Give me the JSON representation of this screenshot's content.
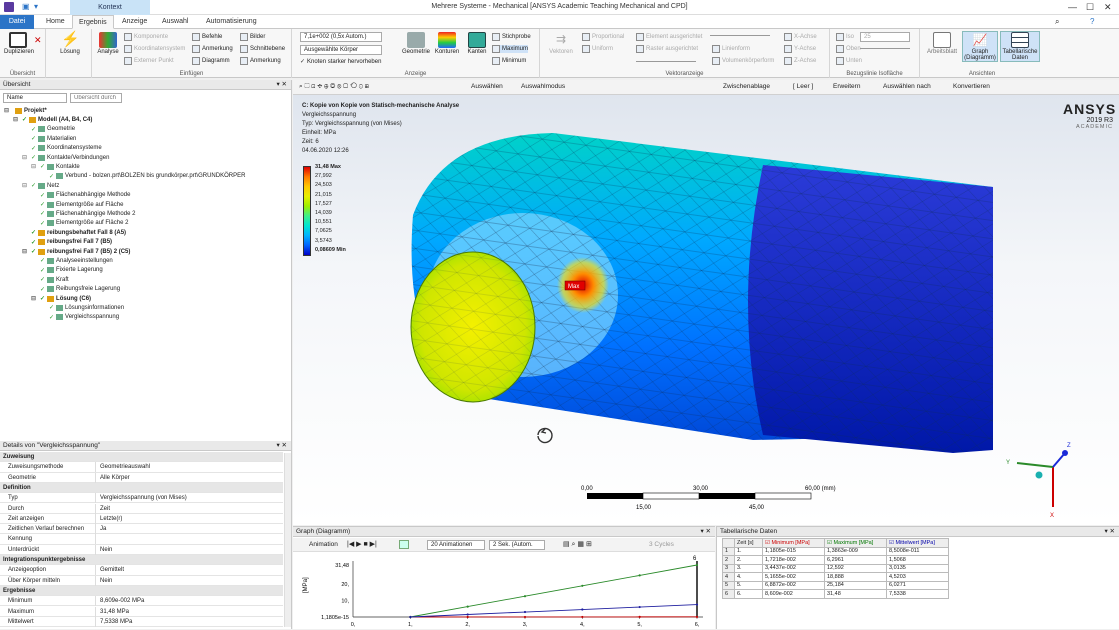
{
  "window": {
    "title": "Mehrere Systeme - Mechanical [ANSYS Academic Teaching Mechanical and CPD]",
    "context_tab": "Kontext",
    "search_placeholder": "Schnellstart"
  },
  "tabs": [
    "Datei",
    "Home",
    "Ergebnis",
    "Anzeige",
    "Auswahl",
    "Automatisierung"
  ],
  "ribbon": {
    "uebersicht": {
      "dup": "Duplizieren",
      "group": "Übersicht"
    },
    "loesung": "Lösung",
    "analyse": "Analyse",
    "einfuegen": {
      "group": "Einfügen",
      "items": [
        "Komponente",
        "Koordinatensystem",
        "Externer Punkt",
        "Befehle",
        "Anmerkung",
        "Diagramm",
        "Bilder",
        "Schnittebene",
        "Anmerkung"
      ]
    },
    "anzeige": {
      "group": "Anzeige",
      "scale": "7,1e+002 (0,5x Autom.)",
      "bodies": "Ausgewählte Körper",
      "knoten": "Knoten starker hervorheben",
      "buttons": [
        "Geometrie",
        "Konturen",
        "Kanten"
      ],
      "probe": [
        "Stichprobe",
        "Maximum",
        "Minimum"
      ]
    },
    "vektor": {
      "group": "Vektoranzeige",
      "items": [
        "Vektoren",
        "Proportional",
        "Uniform",
        "Element ausgerichtet",
        "Raster ausgerichtet",
        "Linienform",
        "Volumenkörperform",
        "X-Achse",
        "Y-Achse",
        "Z-Achse"
      ]
    },
    "bezug": {
      "group": "Bezugslinie Isofläche",
      "items": [
        "Iso",
        "Oben",
        "Unten"
      ],
      "value": "25"
    },
    "ansichten": {
      "group": "Ansichten",
      "items": [
        "Arbeitsblatt",
        "Graph (Diagramm)",
        "Tabellarische Daten"
      ]
    }
  },
  "tree": {
    "title": "Übersicht",
    "filter": "Name",
    "search_placeholder": "Übersicht durch",
    "nodes": [
      {
        "label": "Projekt*",
        "depth": 0,
        "bold": true
      },
      {
        "label": "Modell (A4, B4, C4)",
        "depth": 1,
        "bold": true
      },
      {
        "label": "Geometrie",
        "depth": 2
      },
      {
        "label": "Materialien",
        "depth": 2
      },
      {
        "label": "Koordinatensysteme",
        "depth": 2
      },
      {
        "label": "Kontakte/Verbindungen",
        "depth": 2
      },
      {
        "label": "Kontakte",
        "depth": 3
      },
      {
        "label": "Verbund - bolzen.prt\\BOLZEN bis grundkörper.prt\\GRUNDKÖRPER",
        "depth": 4
      },
      {
        "label": "Netz",
        "depth": 2
      },
      {
        "label": "Flächenabhängige Methode",
        "depth": 3
      },
      {
        "label": "Elementgröße auf Fläche",
        "depth": 3
      },
      {
        "label": "Flächenabhängige Methode 2",
        "depth": 3
      },
      {
        "label": "Elementgröße auf Fläche 2",
        "depth": 3
      },
      {
        "label": "reibungsbehaftet Fall 8 (A5)",
        "depth": 2,
        "bold": true
      },
      {
        "label": "reibungsfrei Fall 7 (B5)",
        "depth": 2,
        "bold": true
      },
      {
        "label": "reibungsfrei Fall 7 (B5) 2 (C5)",
        "depth": 2,
        "bold": true
      },
      {
        "label": "Analyseeinstellungen",
        "depth": 3
      },
      {
        "label": "Fixierte Lagerung",
        "depth": 3
      },
      {
        "label": "Kraft",
        "depth": 3
      },
      {
        "label": "Reibungsfreie Lagerung",
        "depth": 3
      },
      {
        "label": "Lösung (C6)",
        "depth": 3,
        "bold": true
      },
      {
        "label": "Lösungsinformationen",
        "depth": 4
      },
      {
        "label": "Vergleichsspannung",
        "depth": 4
      }
    ]
  },
  "details": {
    "title": "Details von \"Vergleichsspannung\"",
    "rows": [
      {
        "section": "Zuweisung"
      },
      {
        "k": "Zuweisungsmethode",
        "v": "Geometrieauswahl"
      },
      {
        "k": "Geometrie",
        "v": "Alle Körper"
      },
      {
        "section": "Definition"
      },
      {
        "k": "Typ",
        "v": "Vergleichsspannung (von Mises)"
      },
      {
        "k": "Durch",
        "v": "Zeit"
      },
      {
        "k": "Zeit anzeigen",
        "v": "Letzte(r)"
      },
      {
        "k": "Zeitlichen Verlauf berechnen",
        "v": "Ja"
      },
      {
        "k": "Kennung",
        "v": ""
      },
      {
        "k": "Unterdrückt",
        "v": "Nein"
      },
      {
        "section": "Integrationspunktergebnisse"
      },
      {
        "k": "Anzeigeoption",
        "v": "Gemittelt"
      },
      {
        "k": "Über Körper mitteln",
        "v": "Nein"
      },
      {
        "section": "Ergebnisse"
      },
      {
        "k": "Minimum",
        "v": "8,609e-002 MPa"
      },
      {
        "k": "Maximum",
        "v": "31,48 MPa"
      },
      {
        "k": "Mittelwert",
        "v": "7,5338 MPa"
      }
    ]
  },
  "view_toolbar": {
    "select": "Auswählen",
    "mode": "Auswahlmodus",
    "clipboard": "Zwischenablage",
    "empty": "[ Leer ]",
    "expand": "Erweitern",
    "select_by": "Auswählen nach",
    "convert": "Konvertieren"
  },
  "viewport": {
    "header": [
      "C: Kopie von Kopie von Statisch-mechanische Analyse",
      "Vergleichsspannung",
      "Typ: Vergleichsspannung (von Mises)",
      "Einheit: MPa",
      "Zeit: 6",
      "04.06.2020 12:26"
    ],
    "legend": [
      "31,48 Max",
      "27,992",
      "24,503",
      "21,015",
      "17,527",
      "14,039",
      "10,551",
      "7,0625",
      "3,5743",
      "0,08609 Min"
    ],
    "legend_colors": [
      "#e00000",
      "#ff7a00",
      "#ffc800",
      "#e6f000",
      "#9ef000",
      "#3ef08a",
      "#00e6d2",
      "#00b4ff",
      "#0064ff",
      "#0000c8"
    ],
    "max_label": "Max",
    "brand": "ANSYS",
    "version": "2019 R3",
    "academic": "ACADEMIC",
    "scale": {
      "top": [
        "0,00",
        "30,00",
        "60,00 (mm)"
      ],
      "bottom": [
        "15,00",
        "45,00"
      ]
    },
    "triad": [
      "X",
      "Y",
      "Z"
    ]
  },
  "graph": {
    "title": "Graph (Diagramm)",
    "animation": "Animation",
    "frames": "20 Animationen",
    "duration": "2 Sek. (Autom.",
    "cycles": "3 Cycles",
    "ylabel": "[MPa]",
    "yticks": [
      "31,48",
      "20,",
      "10,",
      "1,1805e-15"
    ],
    "xticks": [
      "0,",
      "1,",
      "2,",
      "3,",
      "4,",
      "5,",
      "6,"
    ],
    "last_label": "6",
    "chart_data": {
      "type": "line",
      "x": [
        1,
        2,
        3,
        4,
        5,
        6
      ],
      "series": [
        {
          "name": "Minimum [MPa]",
          "values": [
            1.1805e-15,
            0.017218,
            0.034437,
            0.051655,
            0.068872,
            0.08609
          ],
          "color": "#c00000"
        },
        {
          "name": "Maximum [MPa]",
          "values": [
            1.3863e-09,
            6.2961,
            12.592,
            18.888,
            25.184,
            31.48
          ],
          "color": "#2a8a2a"
        },
        {
          "name": "Mittelwert [MPa]",
          "values": [
            8.5008e-11,
            1.5068,
            3.0135,
            4.5203,
            6.0271,
            7.5338
          ],
          "color": "#2020a0"
        }
      ],
      "ylim": [
        0,
        31.48
      ],
      "xlim": [
        0,
        6
      ]
    }
  },
  "tabular": {
    "title": "Tabellarische Daten",
    "headers": [
      "",
      "Zeit [s]",
      "Minimum [MPa]",
      "Maximum [MPa]",
      "Mittelwert [MPa]"
    ],
    "rows": [
      [
        "1",
        "1.",
        "1,1805e-015",
        "1,3863e-009",
        "8,5008e-011"
      ],
      [
        "2",
        "2.",
        "1,7218e-002",
        "6,2961",
        "1,5068"
      ],
      [
        "3",
        "3.",
        "3,4437e-002",
        "12,592",
        "3,0135"
      ],
      [
        "4",
        "4.",
        "5,1655e-002",
        "18,888",
        "4,5203"
      ],
      [
        "5",
        "5.",
        "6,8872e-002",
        "25,184",
        "6,0271"
      ],
      [
        "6",
        "6.",
        "8,609e-002",
        "31,48",
        "7,5338"
      ]
    ]
  }
}
